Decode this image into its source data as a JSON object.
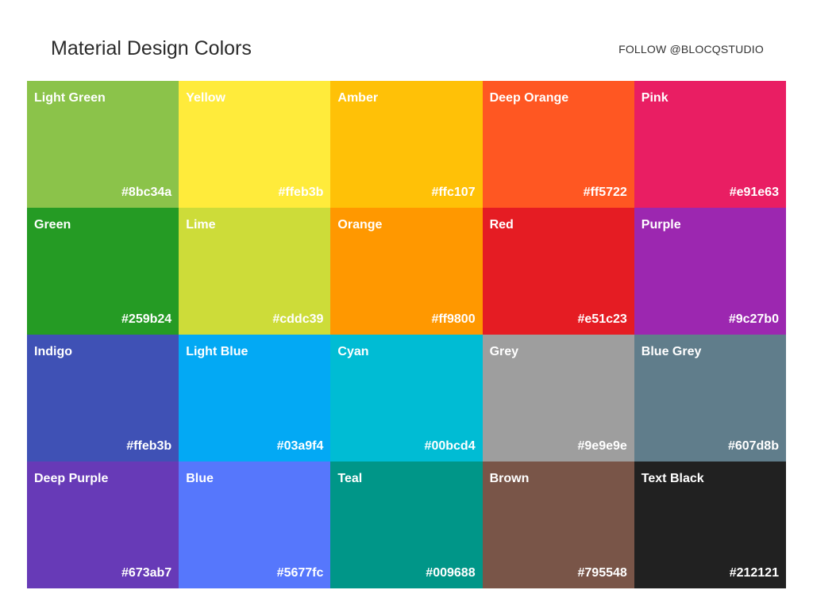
{
  "header": {
    "title": "Material Design Colors",
    "follow_label": "FOLLOW @BLOCQSTUDIO"
  },
  "swatches": [
    {
      "name": "Light Green",
      "hex": "#8bc34a",
      "color": "#8bc34a"
    },
    {
      "name": "Yellow",
      "hex": "#ffeb3b",
      "color": "#ffeb3b"
    },
    {
      "name": "Amber",
      "hex": "#ffc107",
      "color": "#ffc107"
    },
    {
      "name": "Deep Orange",
      "hex": "#ff5722",
      "color": "#ff5722"
    },
    {
      "name": "Pink",
      "hex": "#e91e63",
      "color": "#e91e63"
    },
    {
      "name": "Green",
      "hex": "#259b24",
      "color": "#259b24"
    },
    {
      "name": "Lime",
      "hex": "#cddc39",
      "color": "#cddc39"
    },
    {
      "name": "Orange",
      "hex": "#ff9800",
      "color": "#ff9800"
    },
    {
      "name": "Red",
      "hex": "#e51c23",
      "color": "#e51c23"
    },
    {
      "name": "Purple",
      "hex": "#9c27b0",
      "color": "#9c27b0"
    },
    {
      "name": "Indigo",
      "hex": "#ffeb3b",
      "color": "#3f51b5"
    },
    {
      "name": "Light Blue",
      "hex": "#03a9f4",
      "color": "#03a9f4"
    },
    {
      "name": "Cyan",
      "hex": "#00bcd4",
      "color": "#00bcd4"
    },
    {
      "name": "Grey",
      "hex": "#9e9e9e",
      "color": "#9e9e9e"
    },
    {
      "name": "Blue Grey",
      "hex": "#607d8b",
      "color": "#607d8b"
    },
    {
      "name": "Deep Purple",
      "hex": "#673ab7",
      "color": "#673ab7"
    },
    {
      "name": "Blue",
      "hex": "#5677fc",
      "color": "#5677fc"
    },
    {
      "name": "Teal",
      "hex": "#009688",
      "color": "#009688"
    },
    {
      "name": "Brown",
      "hex": "#795548",
      "color": "#795548"
    },
    {
      "name": "Text Black",
      "hex": "#212121",
      "color": "#212121"
    }
  ]
}
